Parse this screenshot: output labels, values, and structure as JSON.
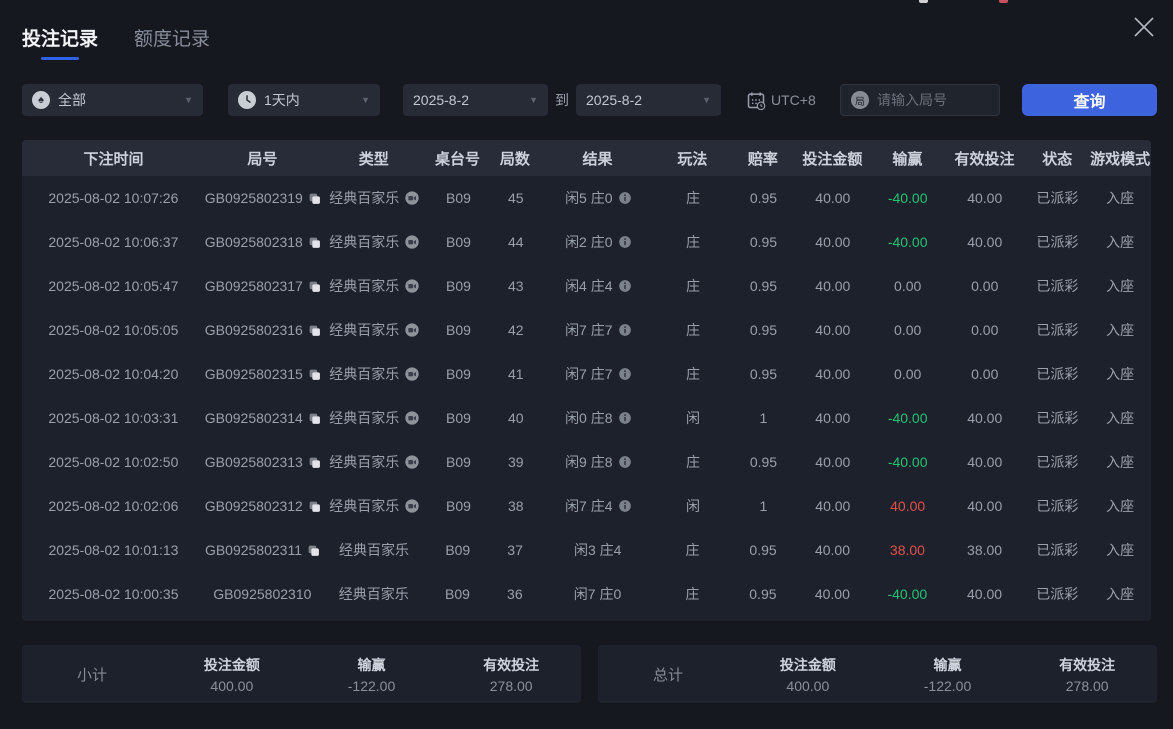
{
  "tabs": [
    {
      "label": "投注记录",
      "active": true
    },
    {
      "label": "额度记录",
      "active": false
    }
  ],
  "filters": {
    "game_type": {
      "value": "全部",
      "icon": "spade-icon"
    },
    "time_range": {
      "value": "1天内",
      "icon": "clock-icon"
    },
    "date_from": "2025-8-2",
    "to_label": "到",
    "date_to": "2025-8-2",
    "timezone": "UTC+8",
    "round_input": {
      "placeholder": "请输入局号"
    },
    "search_button": "查询"
  },
  "table": {
    "headers": [
      "下注时间",
      "局号",
      "类型",
      "桌台号",
      "局数",
      "结果",
      "玩法",
      "赔率",
      "投注金额",
      "输赢",
      "有效投注",
      "状态",
      "游戏模式"
    ],
    "rows": [
      {
        "time": "2025-08-02 10:07:26",
        "id": "GB0925802319",
        "has_copy": true,
        "type": "经典百家乐",
        "has_video": true,
        "table_no": "B09",
        "round": "45",
        "result": "闲5 庄0",
        "has_info": true,
        "play": "庄",
        "odds": "0.95",
        "bet": "40.00",
        "winloss": "-40.00",
        "valid": "40.00",
        "status": "已派彩",
        "mode": "入座"
      },
      {
        "time": "2025-08-02 10:06:37",
        "id": "GB0925802318",
        "has_copy": true,
        "type": "经典百家乐",
        "has_video": true,
        "table_no": "B09",
        "round": "44",
        "result": "闲2 庄0",
        "has_info": true,
        "play": "庄",
        "odds": "0.95",
        "bet": "40.00",
        "winloss": "-40.00",
        "valid": "40.00",
        "status": "已派彩",
        "mode": "入座"
      },
      {
        "time": "2025-08-02 10:05:47",
        "id": "GB0925802317",
        "has_copy": true,
        "type": "经典百家乐",
        "has_video": true,
        "table_no": "B09",
        "round": "43",
        "result": "闲4 庄4",
        "has_info": true,
        "play": "庄",
        "odds": "0.95",
        "bet": "40.00",
        "winloss": "0.00",
        "valid": "0.00",
        "status": "已派彩",
        "mode": "入座"
      },
      {
        "time": "2025-08-02 10:05:05",
        "id": "GB0925802316",
        "has_copy": true,
        "type": "经典百家乐",
        "has_video": true,
        "table_no": "B09",
        "round": "42",
        "result": "闲7 庄7",
        "has_info": true,
        "play": "庄",
        "odds": "0.95",
        "bet": "40.00",
        "winloss": "0.00",
        "valid": "0.00",
        "status": "已派彩",
        "mode": "入座"
      },
      {
        "time": "2025-08-02 10:04:20",
        "id": "GB0925802315",
        "has_copy": true,
        "type": "经典百家乐",
        "has_video": true,
        "table_no": "B09",
        "round": "41",
        "result": "闲7 庄7",
        "has_info": true,
        "play": "庄",
        "odds": "0.95",
        "bet": "40.00",
        "winloss": "0.00",
        "valid": "0.00",
        "status": "已派彩",
        "mode": "入座"
      },
      {
        "time": "2025-08-02 10:03:31",
        "id": "GB0925802314",
        "has_copy": true,
        "type": "经典百家乐",
        "has_video": true,
        "table_no": "B09",
        "round": "40",
        "result": "闲0 庄8",
        "has_info": true,
        "play": "闲",
        "odds": "1",
        "bet": "40.00",
        "winloss": "-40.00",
        "valid": "40.00",
        "status": "已派彩",
        "mode": "入座"
      },
      {
        "time": "2025-08-02 10:02:50",
        "id": "GB0925802313",
        "has_copy": true,
        "type": "经典百家乐",
        "has_video": true,
        "table_no": "B09",
        "round": "39",
        "result": "闲9 庄8",
        "has_info": true,
        "play": "庄",
        "odds": "0.95",
        "bet": "40.00",
        "winloss": "-40.00",
        "valid": "40.00",
        "status": "已派彩",
        "mode": "入座"
      },
      {
        "time": "2025-08-02 10:02:06",
        "id": "GB0925802312",
        "has_copy": true,
        "type": "经典百家乐",
        "has_video": true,
        "table_no": "B09",
        "round": "38",
        "result": "闲7 庄4",
        "has_info": true,
        "play": "闲",
        "odds": "1",
        "bet": "40.00",
        "winloss": "40.00",
        "valid": "40.00",
        "status": "已派彩",
        "mode": "入座"
      },
      {
        "time": "2025-08-02 10:01:13",
        "id": "GB0925802311",
        "has_copy": true,
        "type": "经典百家乐",
        "has_video": false,
        "table_no": "B09",
        "round": "37",
        "result": "闲3 庄4",
        "has_info": false,
        "play": "庄",
        "odds": "0.95",
        "bet": "40.00",
        "winloss": "38.00",
        "valid": "38.00",
        "status": "已派彩",
        "mode": "入座"
      },
      {
        "time": "2025-08-02 10:00:35",
        "id": "GB0925802310",
        "has_copy": false,
        "type": "经典百家乐",
        "has_video": false,
        "table_no": "B09",
        "round": "36",
        "result": "闲7 庄0",
        "has_info": false,
        "play": "庄",
        "odds": "0.95",
        "bet": "40.00",
        "winloss": "-40.00",
        "valid": "40.00",
        "status": "已派彩",
        "mode": "入座"
      }
    ]
  },
  "summary": {
    "panels": [
      {
        "label": "小计",
        "items": [
          {
            "label": "投注金额",
            "value": "400.00",
            "colored": false
          },
          {
            "label": "输赢",
            "value": "-122.00",
            "colored": true
          },
          {
            "label": "有效投注",
            "value": "278.00",
            "colored": false
          }
        ]
      },
      {
        "label": "总计",
        "items": [
          {
            "label": "投注金额",
            "value": "400.00",
            "colored": false
          },
          {
            "label": "输赢",
            "value": "-122.00",
            "colored": true
          },
          {
            "label": "有效投注",
            "value": "278.00",
            "colored": false
          }
        ]
      }
    ]
  },
  "colors": {
    "accent_blue": "#3e63de",
    "loss_green": "#24c272",
    "win_red": "#e0504a"
  }
}
